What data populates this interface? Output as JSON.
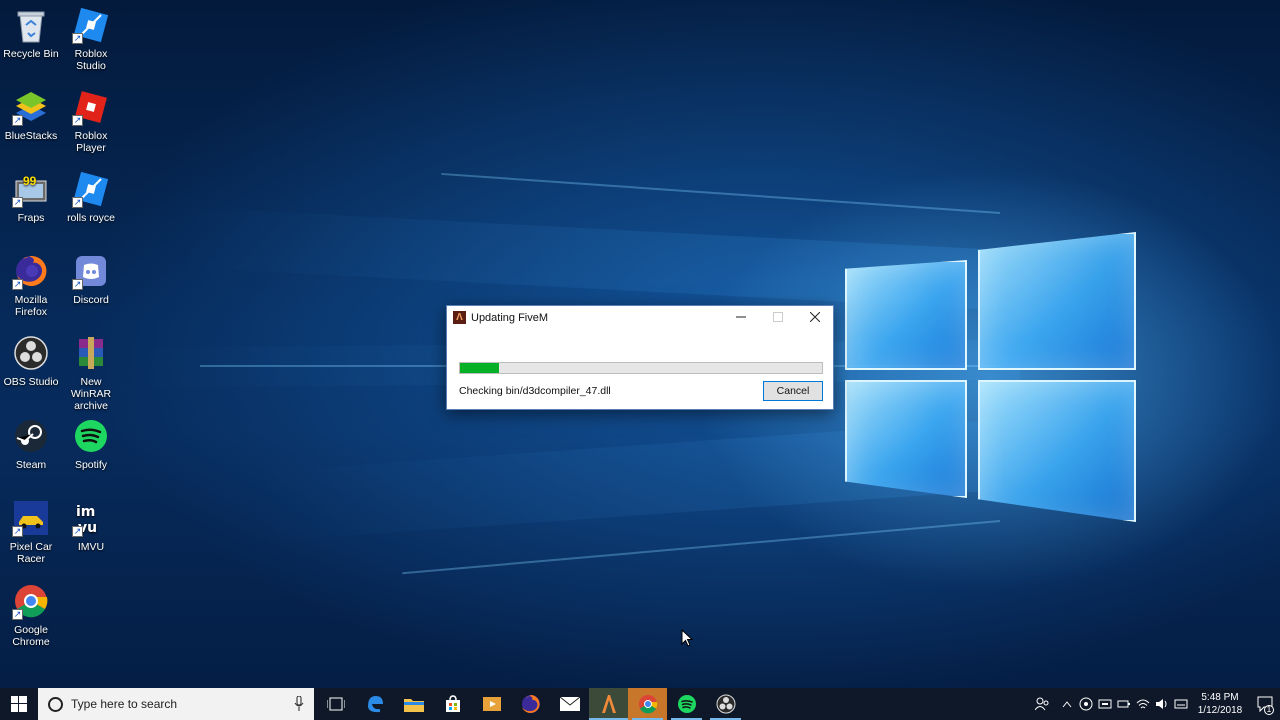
{
  "desktop": {
    "icons": [
      {
        "label": "Recycle Bin",
        "icon": "recycle-bin-icon"
      },
      {
        "label": "Roblox Studio",
        "icon": "roblox-studio-icon"
      },
      {
        "label": "BlueStacks",
        "icon": "bluestacks-icon"
      },
      {
        "label": "Roblox Player",
        "icon": "roblox-player-icon"
      },
      {
        "label": "Fraps",
        "icon": "fraps-icon"
      },
      {
        "label": "rolls royce",
        "icon": "roblox-studio-icon"
      },
      {
        "label": "Mozilla Firefox",
        "icon": "firefox-icon"
      },
      {
        "label": "Discord",
        "icon": "discord-icon"
      },
      {
        "label": "OBS Studio",
        "icon": "obs-icon"
      },
      {
        "label": "New WinRAR archive",
        "icon": "winrar-icon"
      },
      {
        "label": "Steam",
        "icon": "steam-icon"
      },
      {
        "label": "Spotify",
        "icon": "spotify-icon"
      },
      {
        "label": "Pixel Car Racer",
        "icon": "pixel-car-racer-icon"
      },
      {
        "label": "IMVU",
        "icon": "imvu-icon"
      },
      {
        "label": "Google Chrome",
        "icon": "chrome-icon"
      }
    ],
    "fraps_badge": "99"
  },
  "dialog": {
    "title": "Updating FiveM",
    "status": "Checking bin/d3dcompiler_47.dll",
    "progress": 0.107,
    "cancel_label": "Cancel",
    "progress_color": "#06b025"
  },
  "taskbar": {
    "search_placeholder": "Type here to search",
    "pinned": [
      "task-view-icon",
      "edge-icon",
      "file-explorer-icon",
      "store-icon",
      "video-icon",
      "firefox-icon",
      "mail-icon",
      "fivem-icon",
      "chrome-icon",
      "spotify-icon",
      "obs-icon"
    ],
    "clock_time": "5:48 PM",
    "clock_date": "1/12/2018",
    "notification_count": "1"
  },
  "colors": {
    "accent": "#0078d7",
    "taskbar_running": "#76b9ed"
  }
}
